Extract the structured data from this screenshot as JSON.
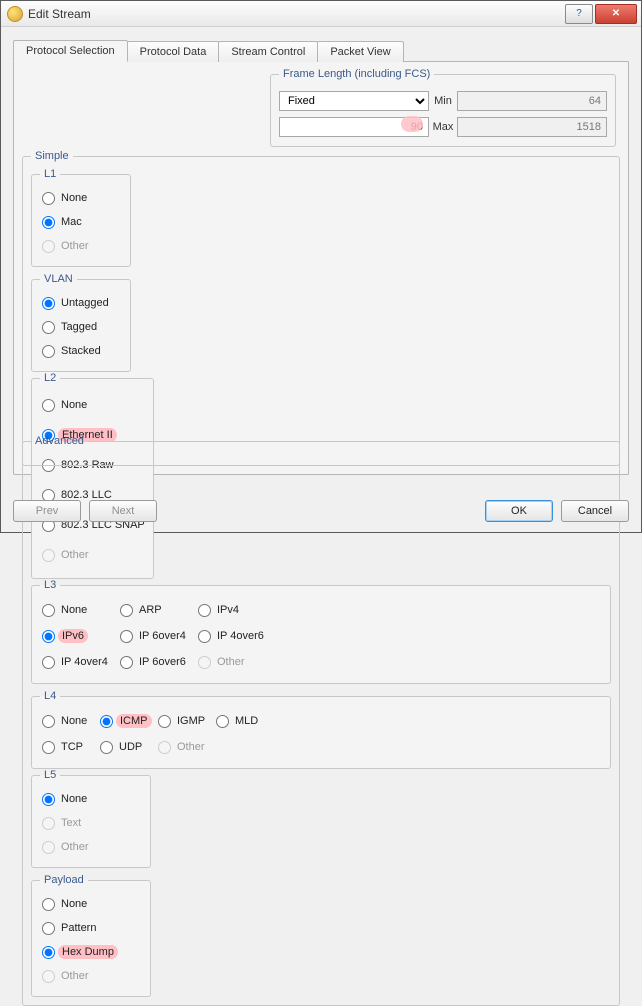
{
  "window": {
    "title": "Edit Stream"
  },
  "tabs": {
    "protocol_selection": "Protocol Selection",
    "protocol_data": "Protocol Data",
    "stream_control": "Stream Control",
    "packet_view": "Packet View"
  },
  "frame_length": {
    "legend": "Frame Length (including FCS)",
    "mode": "Fixed",
    "value": "90",
    "min_label": "Min",
    "min_value": "64",
    "max_label": "Max",
    "max_value": "1518"
  },
  "simple": {
    "legend": "Simple",
    "l1": {
      "legend": "L1",
      "none": "None",
      "mac": "Mac",
      "other": "Other"
    },
    "vlan": {
      "legend": "VLAN",
      "untagged": "Untagged",
      "tagged": "Tagged",
      "stacked": "Stacked"
    },
    "l2": {
      "legend": "L2",
      "none": "None",
      "ethernet2": "Ethernet II",
      "raw": "802.3 Raw",
      "llc": "802.3 LLC",
      "snap": "802.3 LLC SNAP",
      "other": "Other"
    },
    "l3": {
      "legend": "L3",
      "none": "None",
      "arp": "ARP",
      "ipv4": "IPv4",
      "ipv6": "IPv6",
      "ip6o4": "IP 6over4",
      "ip4o6": "IP 4over6",
      "ip4o4": "IP 4over4",
      "ip6o6": "IP 6over6",
      "other": "Other"
    },
    "l4": {
      "legend": "L4",
      "none": "None",
      "icmp": "ICMP",
      "igmp": "IGMP",
      "mld": "MLD",
      "tcp": "TCP",
      "udp": "UDP",
      "other": "Other"
    },
    "l5": {
      "legend": "L5",
      "none": "None",
      "text": "Text",
      "other": "Other"
    },
    "payload": {
      "legend": "Payload",
      "none": "None",
      "pattern": "Pattern",
      "hexdump": "Hex Dump",
      "other": "Other"
    }
  },
  "advanced": {
    "legend": "Advanced"
  },
  "footer": {
    "prev": "Prev",
    "next": "Next",
    "ok": "OK",
    "cancel": "Cancel"
  }
}
